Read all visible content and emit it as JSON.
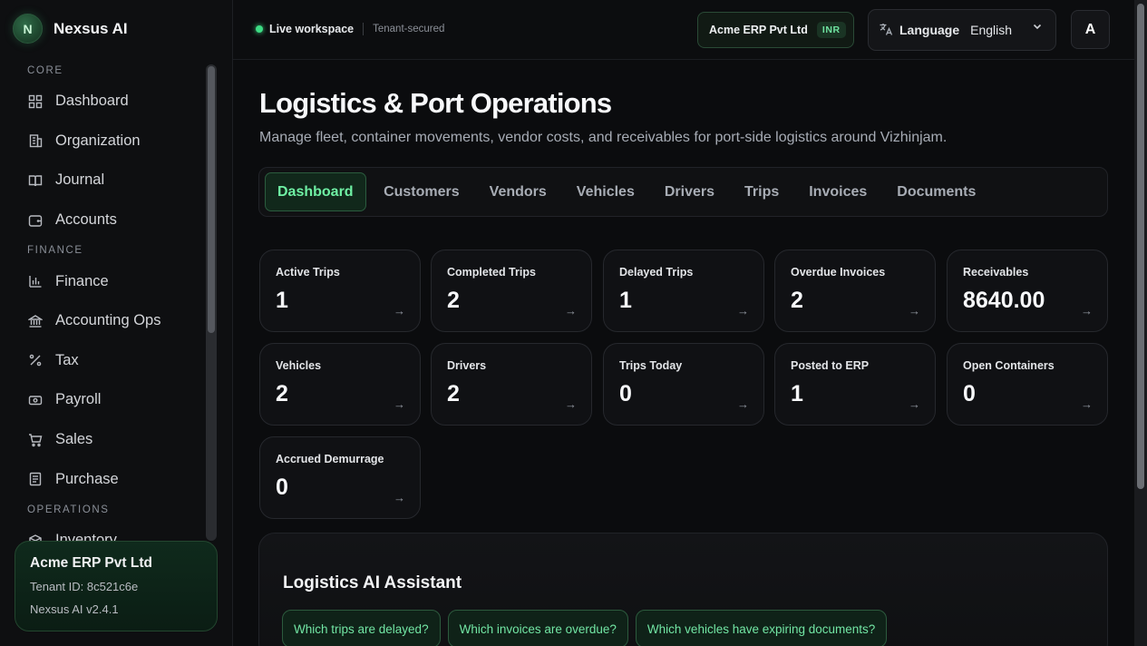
{
  "brand": {
    "logo_letter": "N",
    "name": "Nexsus AI"
  },
  "sidebar": {
    "sections": [
      {
        "label": "CORE",
        "items": [
          {
            "label": "Dashboard",
            "icon": "grid-icon"
          },
          {
            "label": "Organization",
            "icon": "building-icon"
          },
          {
            "label": "Journal",
            "icon": "book-icon"
          },
          {
            "label": "Accounts",
            "icon": "wallet-icon"
          }
        ]
      },
      {
        "label": "FINANCE",
        "items": [
          {
            "label": "Finance",
            "icon": "bar-chart-icon"
          },
          {
            "label": "Accounting Ops",
            "icon": "bank-icon"
          },
          {
            "label": "Tax",
            "icon": "percent-icon"
          },
          {
            "label": "Payroll",
            "icon": "banknote-icon"
          },
          {
            "label": "Sales",
            "icon": "cart-icon"
          },
          {
            "label": "Purchase",
            "icon": "receipt-icon"
          }
        ]
      },
      {
        "label": "OPERATIONS",
        "items": [
          {
            "label": "Inventory",
            "icon": "box-icon"
          }
        ]
      }
    ],
    "tenant": {
      "name": "Acme ERP Pvt Ltd",
      "id": "Tenant ID: 8c521c6e",
      "version": "Nexsus AI v2.4.1"
    }
  },
  "topbar": {
    "live_label": "Live workspace",
    "live_sub": "Tenant-secured",
    "org_name": "Acme ERP Pvt Ltd",
    "currency": "INR",
    "language_label": "Language",
    "language_value": "English",
    "avatar_letter": "A"
  },
  "page": {
    "title": "Logistics & Port Operations",
    "subtitle": "Manage fleet, container movements, vendor costs, and receivables for port-side logistics around Vizhinjam."
  },
  "tabs": [
    "Dashboard",
    "Customers",
    "Vendors",
    "Vehicles",
    "Drivers",
    "Trips",
    "Invoices",
    "Documents"
  ],
  "active_tab": "Dashboard",
  "kpis": [
    {
      "label": "Active Trips",
      "value": "1"
    },
    {
      "label": "Completed Trips",
      "value": "2"
    },
    {
      "label": "Delayed Trips",
      "value": "1"
    },
    {
      "label": "Overdue Invoices",
      "value": "2"
    },
    {
      "label": "Receivables",
      "value": "8640.00"
    },
    {
      "label": "Vehicles",
      "value": "2"
    },
    {
      "label": "Drivers",
      "value": "2"
    },
    {
      "label": "Trips Today",
      "value": "0"
    },
    {
      "label": "Posted to ERP",
      "value": "1"
    },
    {
      "label": "Open Containers",
      "value": "0"
    },
    {
      "label": "Accrued Demurrage",
      "value": "0"
    }
  ],
  "assistant": {
    "title": "Logistics AI Assistant",
    "prompts": [
      "Which trips are delayed?",
      "Which invoices are overdue?",
      "Which vehicles have expiring documents?"
    ]
  },
  "colors": {
    "accent": "#6ff0a4",
    "live": "#3ddc84",
    "background": "#0b0c0e"
  }
}
